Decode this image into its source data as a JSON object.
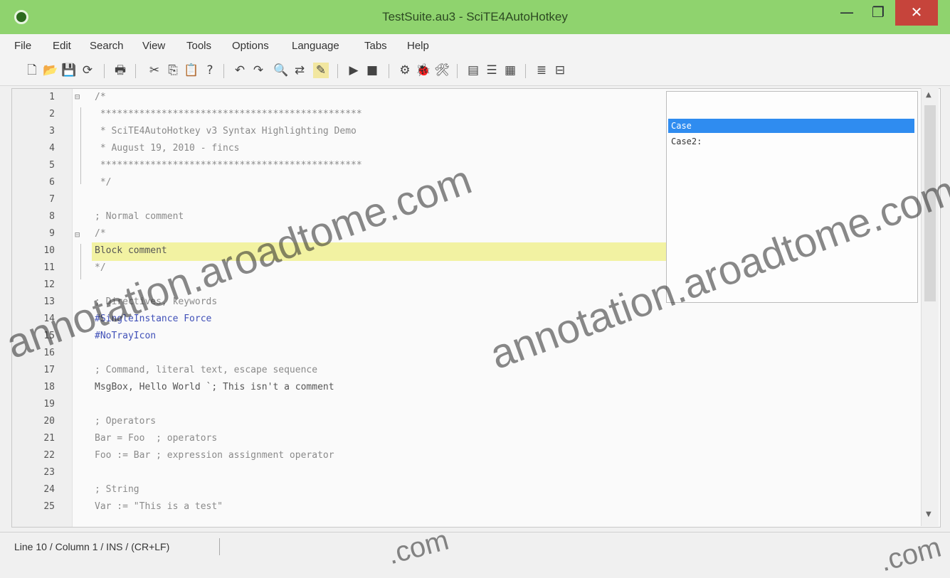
{
  "window": {
    "title": "TestSuite.au3 - SciTE4AutoHotkey",
    "min_glyph": "—",
    "max_glyph": "❐",
    "close_glyph": "✕"
  },
  "menu": [
    "File",
    "Edit",
    "Search",
    "View",
    "Tools",
    "Options",
    "Language",
    "Tabs",
    "Help"
  ],
  "toolbar_icons": [
    "new-file-icon",
    "open-icon",
    "save-icon",
    "reload-icon",
    "print-icon",
    "cut-icon",
    "copy-icon",
    "paste-icon",
    "help-icon",
    "undo-icon",
    "redo-icon",
    "find-icon",
    "replace-icon",
    "highlight-icon",
    "run-icon",
    "stop-icon",
    "settings-icon",
    "debug-icon",
    "tools-icon",
    "panel-icon",
    "list-icon",
    "table-icon",
    "outline-icon",
    "split-icon"
  ],
  "editor": {
    "line_numbers": [
      "1",
      "2",
      "3",
      "4",
      "5",
      "6",
      "7",
      "8",
      "9",
      "10",
      "11",
      "12",
      "13",
      "14",
      "15",
      "16",
      "17",
      "18",
      "19",
      "20",
      "21",
      "22",
      "23",
      "24",
      "25"
    ],
    "lines": [
      "/*",
      " ***********************************************",
      " * SciTE4AutoHotkey v3 Syntax Highlighting Demo",
      " * August 19, 2010 - fincs",
      " ***********************************************",
      " */",
      "",
      "; Normal comment",
      "/*",
      "Block comment",
      "*/",
      "",
      "; Directives, keywords",
      "#SingleInstance Force",
      "#NoTrayIcon",
      "",
      "; Command, literal text, escape sequence",
      "MsgBox, Hello World `; This isn't a comment",
      "",
      "; Operators",
      "Bar = Foo  ; operators",
      "Foo := Bar ; expression assignment operator",
      "",
      "; String",
      "Var := \"This is a test\""
    ]
  },
  "autocomplete": {
    "items": [
      "Case",
      "Case2:"
    ]
  },
  "status": {
    "text": "Line 10 / Column 1 / INS / (CR+LF)"
  },
  "watermark": {
    "text1": "annotation.aroadtome.com",
    "text2": "annotation.aroadtome.com",
    "text3": ".com",
    "text4": ".com"
  }
}
